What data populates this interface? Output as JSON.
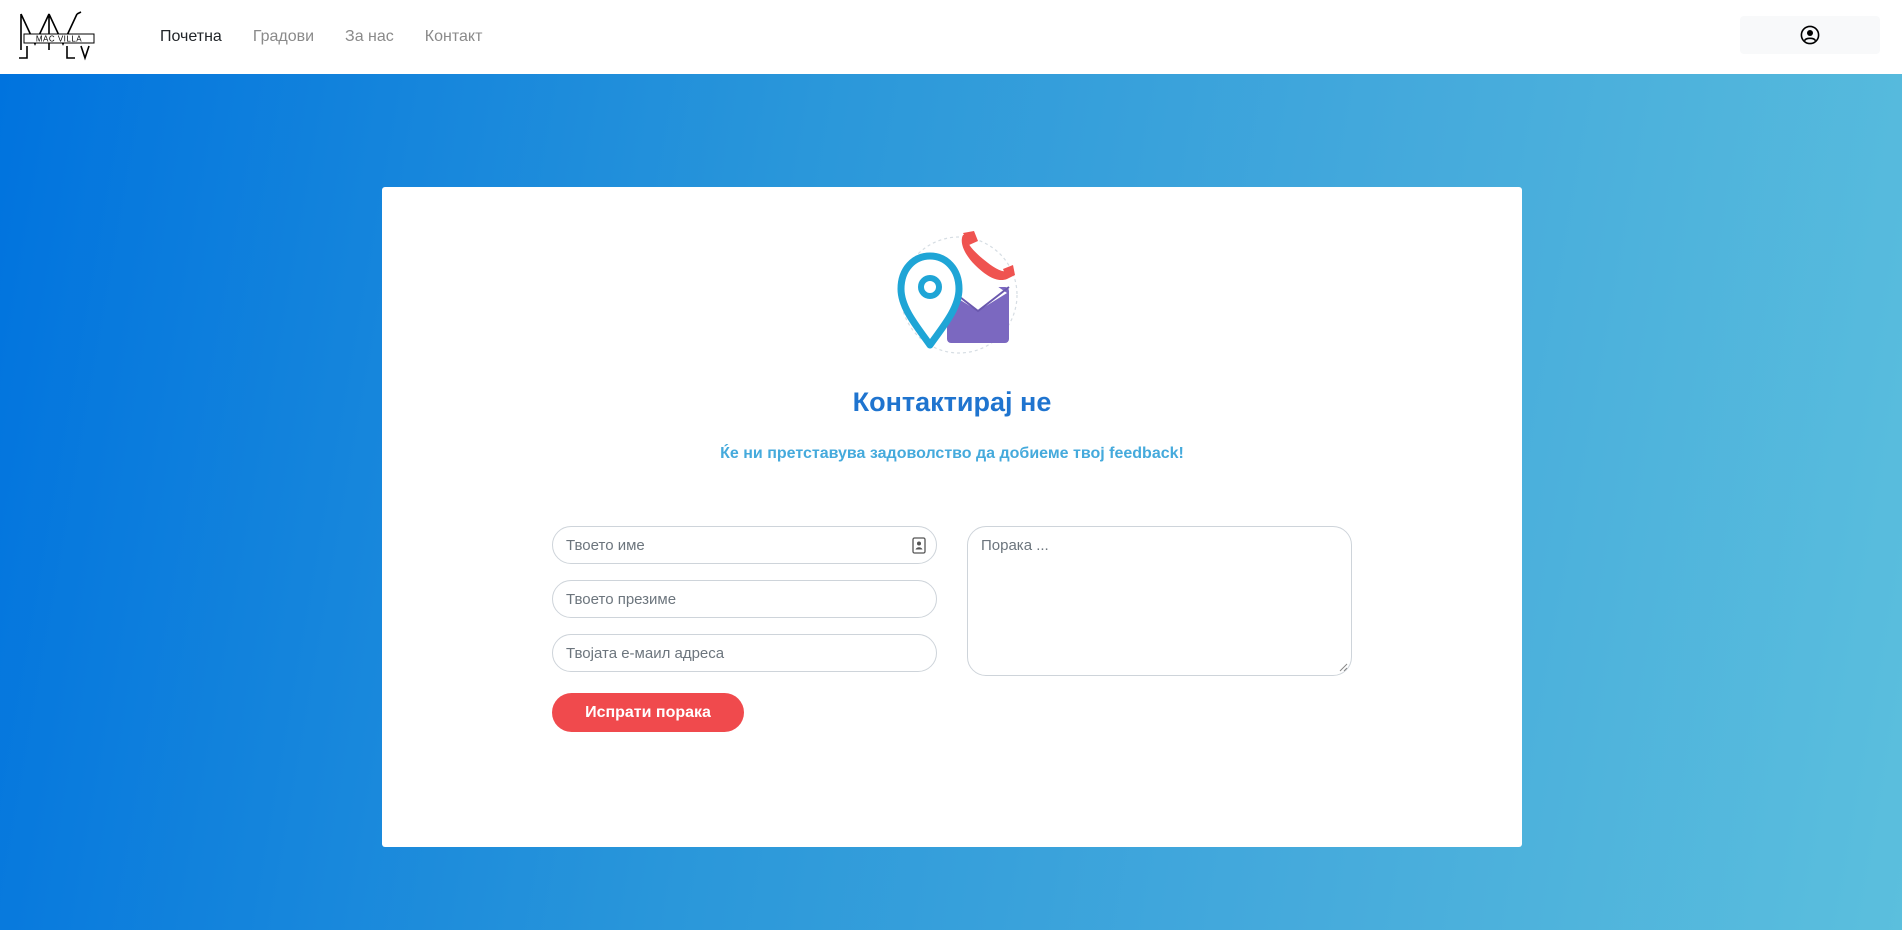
{
  "brand": {
    "logo_top_text": "MV",
    "logo_middle_text": "MAC VILLA",
    "logo_bottom_text": "LV"
  },
  "nav": {
    "items": [
      {
        "label": "Почетна",
        "active": true
      },
      {
        "label": "Градови",
        "active": false
      },
      {
        "label": "За нас",
        "active": false
      },
      {
        "label": "Контакт",
        "active": false
      }
    ]
  },
  "header": {
    "user_icon": "user-circle-icon"
  },
  "contact": {
    "illustration_icons": [
      "location-pin-icon",
      "phone-icon",
      "envelope-icon"
    ],
    "title": "Контактирај не",
    "subtitle": "Ќе ни претставува задоволство да добиеме твој feedback!",
    "form": {
      "first_name_placeholder": "Твоето име",
      "first_name_value": "",
      "last_name_placeholder": "Твоето презиме",
      "last_name_value": "",
      "email_placeholder": "Твојата е-маил адреса",
      "email_value": "",
      "message_placeholder": "Порака ...",
      "message_value": "",
      "submit_label": "Испрати порака"
    }
  },
  "colors": {
    "gradient_start": "#0073de",
    "gradient_end": "#5bbfdd",
    "title": "#1f74cf",
    "subtitle": "#45aadc",
    "submit": "#f04a4d",
    "pin": "#1fa5d6",
    "phone": "#ef5350",
    "envelope": "#7b68c0"
  }
}
